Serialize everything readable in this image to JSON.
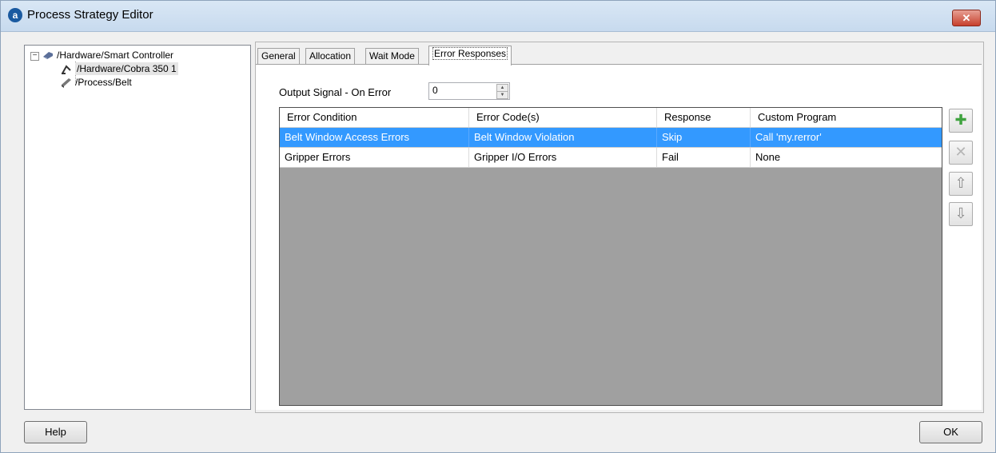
{
  "window": {
    "title": "Process Strategy Editor",
    "close_label": "✕"
  },
  "tree": {
    "items": [
      {
        "label": "/Hardware/Smart Controller"
      },
      {
        "label": "/Hardware/Cobra 350 1"
      },
      {
        "label": "/Process/Belt"
      }
    ],
    "expander": "−"
  },
  "tabs": [
    {
      "label": "General"
    },
    {
      "label": "Allocation"
    },
    {
      "label": "Wait Mode"
    },
    {
      "label": "Error Responses"
    }
  ],
  "output_signal": {
    "label": "Output Signal - On Error",
    "value": "0"
  },
  "grid": {
    "columns": [
      "Error Condition",
      "Error Code(s)",
      "Response",
      "Custom Program"
    ],
    "rows": [
      [
        "Belt Window Access Errors",
        "Belt Window Violation",
        "Skip",
        "Call 'my.rerror'"
      ],
      [
        "Gripper Errors",
        "Gripper I/O Errors",
        "Fail",
        "None"
      ]
    ]
  },
  "side_buttons": {
    "add": "✚",
    "remove": "✕",
    "up": "⇧",
    "down": "⇩"
  },
  "buttons": {
    "help": "Help",
    "ok": "OK"
  },
  "colors": {
    "selection": "#3399ff",
    "add_icon": "#3fa33f",
    "grid_empty": "#a0a0a0"
  }
}
